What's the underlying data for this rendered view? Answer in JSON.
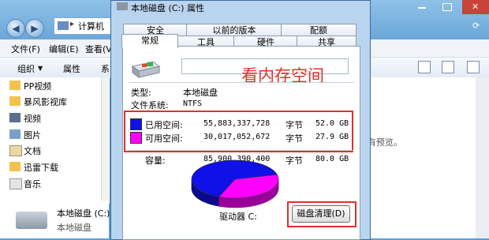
{
  "explorer": {
    "breadcrumb": "计算机",
    "menu": [
      "文件(F)",
      "编辑(E)",
      "查看(V)"
    ],
    "toolbar": [
      "组织",
      "属性",
      "系"
    ],
    "sidebar": [
      "PP视频",
      "暴风影视库",
      "视频",
      "图片",
      "文档",
      "迅雷下载",
      "音乐"
    ],
    "preview_text": "没有预览。",
    "drive_name": "本地磁盘 (C:)",
    "drive_sub": "本地磁盘"
  },
  "dialog": {
    "title": "本地磁盘 (C:) 属性",
    "tabs_row1": [
      "安全",
      "以前的版本",
      "配额"
    ],
    "tabs_row2": [
      "常规",
      "工具",
      "硬件",
      "共享"
    ],
    "annotation": "看内存空间",
    "type_label": "类型:",
    "type_value": "本地磁盘",
    "fs_label": "文件系统:",
    "fs_value": "NTFS",
    "used": {
      "label": "已用空间:",
      "bytes": "55,883,337,728",
      "unit": "字节",
      "size": "52.0 GB",
      "color": "#1010e8"
    },
    "free": {
      "label": "可用空间:",
      "bytes": "30,017,052,672",
      "unit": "字节",
      "size": "27.9 GB",
      "color": "#ff00ff"
    },
    "capacity": {
      "label": "容量:",
      "bytes": "85,900,390,400",
      "unit": "字节",
      "size": "80.0 GB"
    },
    "drive_label": "驱动器 C:",
    "cleanup_button": "磁盘清理(D)"
  },
  "chart_data": {
    "type": "pie",
    "categories": [
      "已用空间",
      "可用空间"
    ],
    "values": [
      52.0,
      27.9
    ],
    "colors": [
      "#1010e8",
      "#ff00ff"
    ]
  }
}
